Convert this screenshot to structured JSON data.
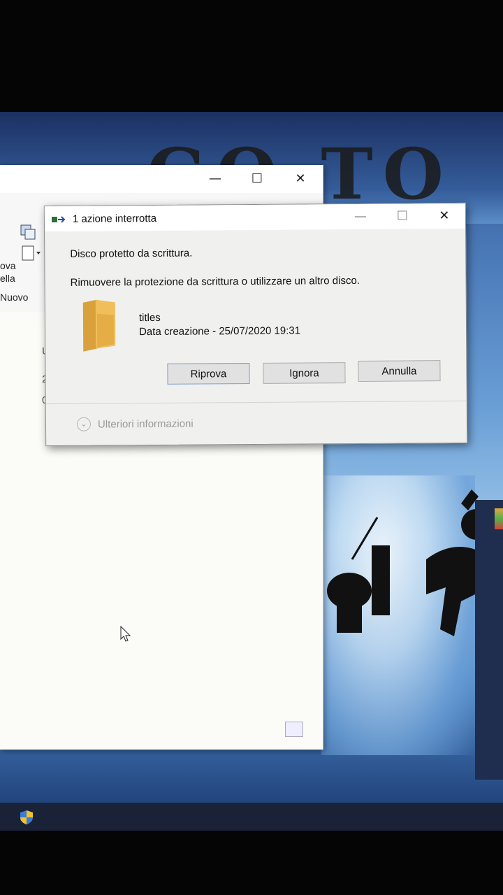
{
  "dialog": {
    "title": "1 azione interrotta",
    "message_primary": "Disco protetto da scrittura.",
    "message_secondary": "Rimuovere la protezione da scrittura o utilizzare un altro disco.",
    "item": {
      "name": "titles",
      "detail": "Data creazione - 25/07/2020 19:31",
      "icon": "folder-icon"
    },
    "buttons": {
      "retry": "Riprova",
      "ignore": "Ignora",
      "cancel": "Annulla"
    },
    "more_info": "Ulteriori informazioni",
    "controls": {
      "minimize": "—",
      "maximize": "☐",
      "close": "✕"
    }
  },
  "explorer": {
    "controls": {
      "minimize": "—",
      "maximize": "☐",
      "close": "✕"
    },
    "ribbon_fragments": [
      "ova",
      "ella",
      "Nuovo"
    ],
    "content_fragments": [
      "U",
      "2",
      "0"
    ]
  },
  "wallpaper": {
    "poster_text": "GO TO"
  },
  "colors": {
    "dialog_bg": "#f0f0ee",
    "button_bg": "#e1e1e1",
    "folder": "#e8b24a",
    "taskbar": "#1a2238"
  }
}
